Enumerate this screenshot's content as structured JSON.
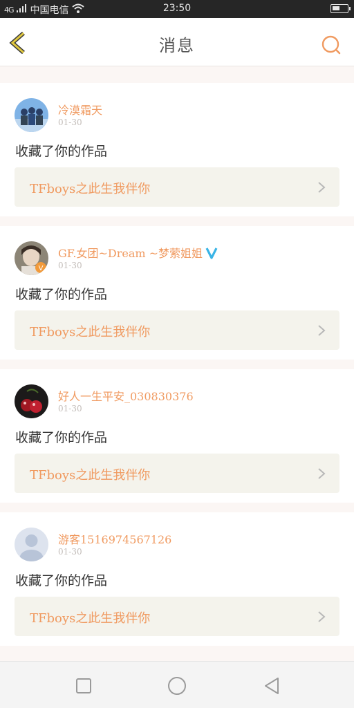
{
  "status_bar": {
    "signal": "4G",
    "carrier": "中国电信",
    "time": "23:50"
  },
  "header": {
    "title": "消息"
  },
  "messages": [
    {
      "username": "冷漠霜天",
      "date": "01-30",
      "action": "收藏了你的作品",
      "work_title": "TFboys之此生我伴你",
      "verified": false
    },
    {
      "username": "GF.女团~Dream ~梦萦姐姐",
      "date": "01-30",
      "action": "收藏了你的作品",
      "work_title": "TFboys之此生我伴你",
      "verified": true
    },
    {
      "username": "好人一生平安_030830376",
      "date": "01-30",
      "action": "收藏了你的作品",
      "work_title": "TFboys之此生我伴你",
      "verified": false
    },
    {
      "username": "游客1516974567126",
      "date": "01-30",
      "action": "收藏了你的作品",
      "work_title": "TFboys之此生我伴你",
      "verified": false
    }
  ],
  "colors": {
    "accent": "#f09a60",
    "back_arrow": "#d8c248",
    "verified": "#3ab4e6"
  }
}
